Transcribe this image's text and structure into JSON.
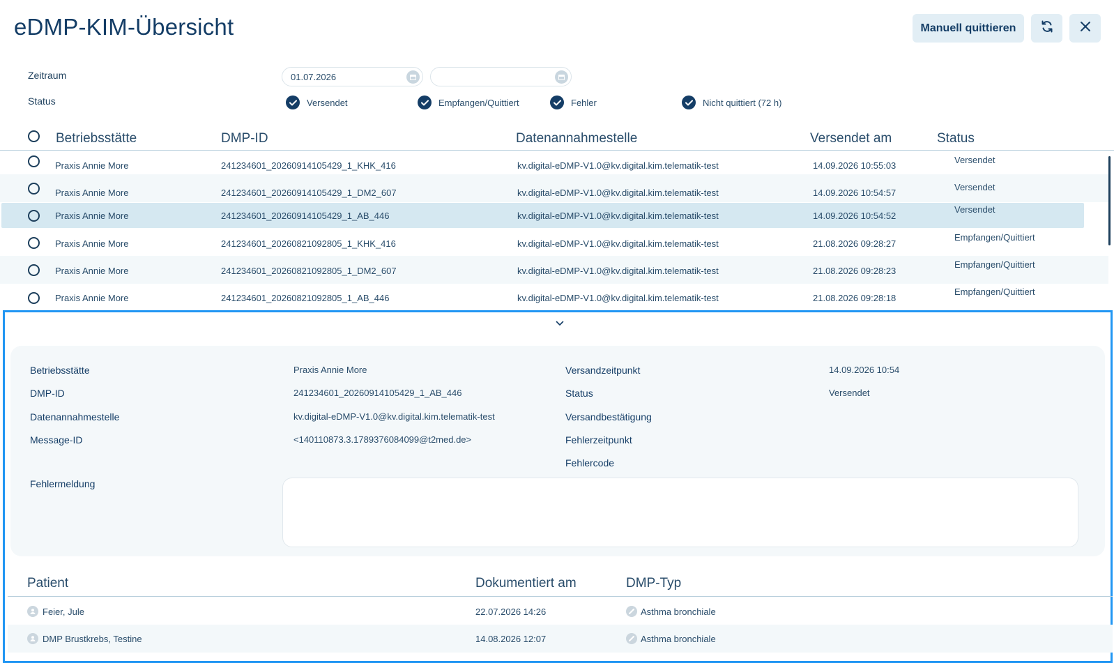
{
  "header": {
    "title": "eDMP-KIM-Übersicht",
    "manual_ack_label": "Manuell quittieren",
    "refresh_icon": "refresh-icon",
    "close_icon": "close-icon"
  },
  "filters": {
    "zeitraum_label": "Zeitraum",
    "date_from": "01.07.2026",
    "date_to": "",
    "status_label": "Status",
    "status_options": [
      {
        "label": "Versendet",
        "checked": true
      },
      {
        "label": "Empfangen/Quittiert",
        "checked": true
      },
      {
        "label": "Fehler",
        "checked": true
      },
      {
        "label": "Nicht quittiert (72 h)",
        "checked": true
      }
    ]
  },
  "table": {
    "columns": [
      "Betriebsstätte",
      "DMP-ID",
      "Datenannahmestelle",
      "Versendet am",
      "Status"
    ],
    "rows": [
      {
        "betriebsstaette": "Praxis Annie More",
        "dmp_id": "241234601_20260914105429_1_KHK_416",
        "datenannahmestelle": "kv.digital-eDMP-V1.0@kv.digital.kim.telematik-test",
        "versendet_am": "14.09.2026 10:55:03",
        "status": "Versendet"
      },
      {
        "betriebsstaette": "Praxis Annie More",
        "dmp_id": "241234601_20260914105429_1_DM2_607",
        "datenannahmestelle": "kv.digital-eDMP-V1.0@kv.digital.kim.telematik-test",
        "versendet_am": "14.09.2026 10:54:57",
        "status": "Versendet"
      },
      {
        "betriebsstaette": "Praxis Annie More",
        "dmp_id": "241234601_20260914105429_1_AB_446",
        "datenannahmestelle": "kv.digital-eDMP-V1.0@kv.digital.kim.telematik-test",
        "versendet_am": "14.09.2026 10:54:52",
        "status": "Versendet"
      },
      {
        "betriebsstaette": "Praxis Annie More",
        "dmp_id": "241234601_20260821092805_1_KHK_416",
        "datenannahmestelle": "kv.digital-eDMP-V1.0@kv.digital.kim.telematik-test",
        "versendet_am": "21.08.2026 09:28:27",
        "status": "Empfangen/Quittiert"
      },
      {
        "betriebsstaette": "Praxis Annie More",
        "dmp_id": "241234601_20260821092805_1_DM2_607",
        "datenannahmestelle": "kv.digital-eDMP-V1.0@kv.digital.kim.telematik-test",
        "versendet_am": "21.08.2026 09:28:23",
        "status": "Empfangen/Quittiert"
      },
      {
        "betriebsstaette": "Praxis Annie More",
        "dmp_id": "241234601_20260821092805_1_AB_446",
        "datenannahmestelle": "kv.digital-eDMP-V1.0@kv.digital.kim.telematik-test",
        "versendet_am": "21.08.2026 09:28:18",
        "status": "Empfangen/Quittiert"
      }
    ]
  },
  "detail": {
    "betriebsstaette_label": "Betriebsstätte",
    "betriebsstaette_value": "Praxis Annie More",
    "dmp_id_label": "DMP-ID",
    "dmp_id_value": "241234601_20260914105429_1_AB_446",
    "datenannahmestelle_label": "Datenannahmestelle",
    "datenannahmestelle_value": "kv.digital-eDMP-V1.0@kv.digital.kim.telematik-test",
    "message_id_label": "Message-ID",
    "message_id_value": "<140110873.3.1789376084099@t2med.de>",
    "versandzeitpunkt_label": "Versandzeitpunkt",
    "versandzeitpunkt_value": "14.09.2026 10:54",
    "status_label": "Status",
    "status_value": "Versendet",
    "versandbestaetigung_label": "Versandbestätigung",
    "fehlerzeitpunkt_label": "Fehlerzeitpunkt",
    "fehlercode_label": "Fehlercode",
    "fehlermeldung_label": "Fehlermeldung",
    "fehlermeldung_value": ""
  },
  "patients": {
    "columns": [
      "Patient",
      "Dokumentiert am",
      "DMP-Typ"
    ],
    "rows": [
      {
        "name": "Feier, Jule",
        "dokumentiert_am": "22.07.2026 14:26",
        "dmp_typ": "Asthma bronchiale"
      },
      {
        "name": "DMP Brustkrebs, Testine",
        "dokumentiert_am": "14.08.2026 12:07",
        "dmp_typ": "Asthma bronchiale"
      }
    ]
  }
}
